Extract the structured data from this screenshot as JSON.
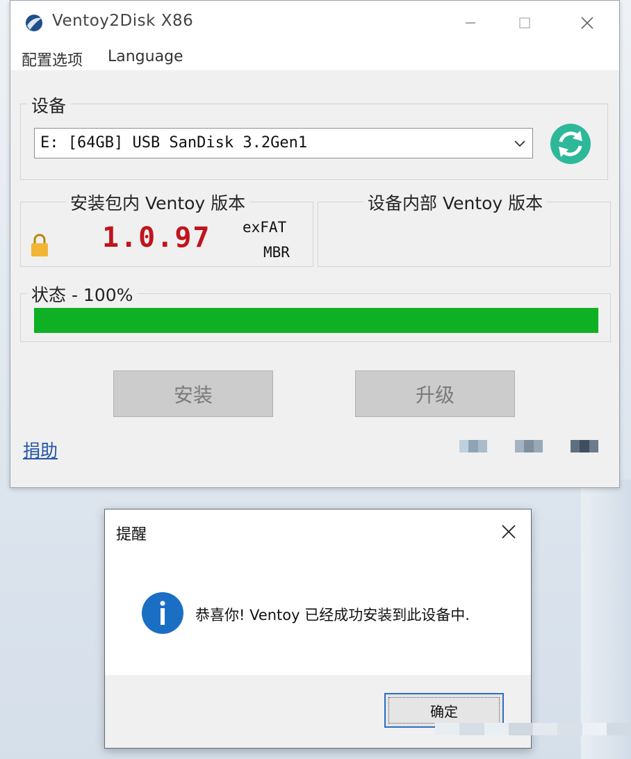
{
  "window": {
    "title": "Ventoy2Disk  X86",
    "menu": [
      "配置选项",
      "Language"
    ]
  },
  "device": {
    "group_label": "设备",
    "selected": "E: [64GB] USB SanDisk 3.2Gen1"
  },
  "package_version": {
    "label": "安装包内 Ventoy 版本",
    "version": "1.0.97",
    "fs": "exFAT",
    "partition": "MBR"
  },
  "device_version": {
    "label": "设备内部 Ventoy 版本",
    "version": ""
  },
  "status": {
    "label": "状态 - 100%",
    "progress_percent": 100
  },
  "buttons": {
    "install": "安装",
    "upgrade": "升级"
  },
  "donate_link": "捐助",
  "dialog": {
    "title": "提醒",
    "message": "恭喜你! Ventoy 已经成功安装到此设备中.",
    "ok": "确定"
  },
  "colors": {
    "progress": "#0fb024",
    "version_text": "#c0141c",
    "refresh_icon": "#2eb89a",
    "info_icon": "#1a6fc4"
  }
}
